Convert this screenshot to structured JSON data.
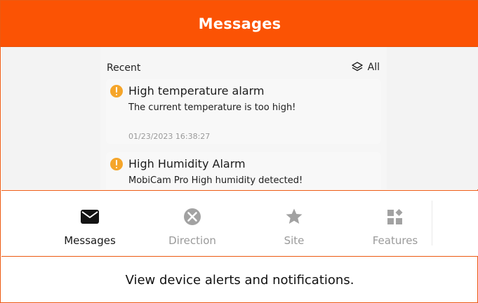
{
  "header": {
    "title": "Messages"
  },
  "recent": {
    "label": "Recent",
    "filter_label": "All"
  },
  "messages": [
    {
      "title": "High temperature alarm",
      "body": "The current temperature is too high!",
      "time": "01/23/2023 16:38:27"
    },
    {
      "title": "High Humidity Alarm",
      "body": "MobiCam Pro High humidity detected!"
    }
  ],
  "tabs": [
    {
      "label": "Messages",
      "icon": "envelope-icon",
      "active": true
    },
    {
      "label": "Direction",
      "icon": "direction-icon",
      "active": false
    },
    {
      "label": "Site",
      "icon": "star-icon",
      "active": false
    },
    {
      "label": "Features",
      "icon": "features-grid-icon",
      "active": false
    }
  ],
  "caption": "View device alerts and notifications.",
  "colors": {
    "brand": "#fb5304",
    "alert": "#f5a52a",
    "active_tab": "#1a1a1a",
    "inactive_tab": "#9a9a9a"
  }
}
